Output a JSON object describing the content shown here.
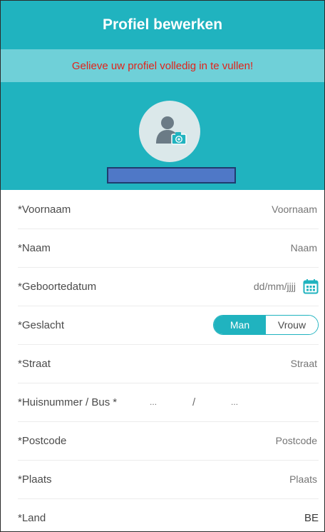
{
  "header": {
    "title": "Profiel bewerken",
    "notice": "Gelieve uw profiel volledig in te vullen!"
  },
  "colors": {
    "accent": "#20b3bf",
    "notice_bg": "#6fd0d8",
    "notice_text": "#e2231a",
    "name_bar": "#4f78c7"
  },
  "form": {
    "voornaam": {
      "label": "*Voornaam",
      "placeholder": "Voornaam"
    },
    "naam": {
      "label": "*Naam",
      "placeholder": "Naam"
    },
    "geboortedatum": {
      "label": "*Geboortedatum",
      "placeholder": "dd/mm/jjjj",
      "icon": "calendar-icon"
    },
    "geslacht": {
      "label": "*Geslacht",
      "option_man": "Man",
      "option_vrouw": "Vrouw",
      "selected": "Man"
    },
    "straat": {
      "label": "*Straat",
      "placeholder": "Straat"
    },
    "huisnummer": {
      "label": "*Huisnummer / Bus",
      "required": "*",
      "placeholder_nr": "...",
      "separator": "/",
      "placeholder_bus": "..."
    },
    "postcode": {
      "label": "*Postcode",
      "placeholder": "Postcode"
    },
    "plaats": {
      "label": "*Plaats",
      "placeholder": "Plaats"
    },
    "land": {
      "label": "*Land",
      "value": "BE"
    }
  }
}
